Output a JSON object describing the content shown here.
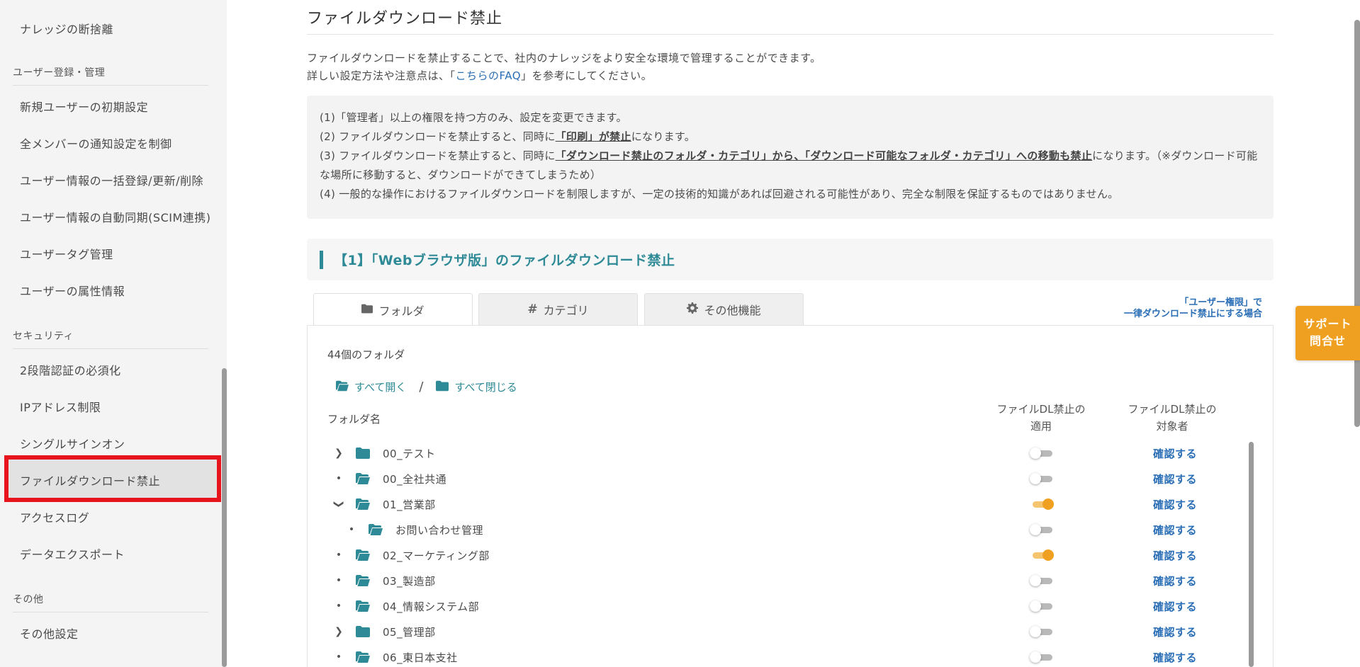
{
  "sidebar": {
    "top_item": "ナレッジの断捨離",
    "sections": [
      {
        "title": "ユーザー登録・管理",
        "items": [
          "新規ユーザーの初期設定",
          "全メンバーの通知設定を制御",
          "ユーザー情報の一括登録/更新/削除",
          "ユーザー情報の自動同期(SCIM連携)",
          "ユーザータグ管理",
          "ユーザーの属性情報"
        ]
      },
      {
        "title": "セキュリティ",
        "items": [
          "2段階認証の必須化",
          "IPアドレス制限",
          "シングルサインオン",
          "ファイルダウンロード禁止",
          "アクセスログ",
          "データエクスポート"
        ]
      },
      {
        "title": "その他",
        "items": [
          "その他設定"
        ]
      }
    ],
    "highlight_color": "#e8141d"
  },
  "page": {
    "title": "ファイルダウンロード禁止",
    "intro_line1": "ファイルダウンロードを禁止することで、社内のナレッジをより安全な環境で管理することができます。",
    "intro_line2_pre": "詳しい設定方法や注意点は、「",
    "intro_link": "こちらのFAQ",
    "intro_line2_post": "」を参考にしてください。"
  },
  "notes": {
    "n1": "(1)「管理者」以上の権限を持つ方のみ、設定を変更できます。",
    "n2_pre": "(2) ファイルダウンロードを禁止すると、同時に",
    "n2_u": "「印刷」が禁止",
    "n2_post": "になります。",
    "n3_pre": "(3) ファイルダウンロードを禁止すると、同時に",
    "n3_u": "「ダウンロード禁止のフォルダ・カテゴリ」から、「ダウンロード可能なフォルダ・カテゴリ」への移動も禁止",
    "n3_post": "になります。（※ダウンロード可能な場所に移動すると、ダウンロードができてしまうため）",
    "n4": "(4) 一般的な操作におけるファイルダウンロードを制限しますが、一定の技術的知識があれば回避される可能性があり、完全な制限を保証するものではありません。"
  },
  "section1": {
    "title": "【1】「Webブラウザ版」のファイルダウンロード禁止"
  },
  "tabs": [
    {
      "label": "フォルダ",
      "icon": "folder-icon"
    },
    {
      "label": "カテゴリ",
      "icon": "hash-icon"
    },
    {
      "label": "その他機能",
      "icon": "gear-icon"
    }
  ],
  "perm_link": {
    "line1": "「ユーザー権限」で",
    "line2": "一律ダウンロード禁止にする場合"
  },
  "folders": {
    "count_label": "44個のフォルダ",
    "open_all": "すべて開く",
    "separator": "/",
    "close_all": "すべて閉じる",
    "col_name": "フォルダ名",
    "col_apply_1": "ファイルDL禁止の",
    "col_apply_2": "適用",
    "col_target_1": "ファイルDL禁止の",
    "col_target_2": "対象者",
    "confirm_label": "確認する",
    "rows": [
      {
        "name": "00_テスト",
        "lead": "chevron-right",
        "icon": "folder-closed",
        "depth": 0,
        "enabled": false
      },
      {
        "name": "00_全社共通",
        "lead": "bullet",
        "icon": "folder-open",
        "depth": 0,
        "enabled": false
      },
      {
        "name": "01_営業部",
        "lead": "chevron-down",
        "icon": "folder-open",
        "depth": 0,
        "enabled": true
      },
      {
        "name": "お問い合わせ管理",
        "lead": "bullet",
        "icon": "folder-open",
        "depth": 1,
        "enabled": false
      },
      {
        "name": "02_マーケティング部",
        "lead": "bullet",
        "icon": "folder-open",
        "depth": 0,
        "enabled": true
      },
      {
        "name": "03_製造部",
        "lead": "bullet",
        "icon": "folder-open",
        "depth": 0,
        "enabled": false
      },
      {
        "name": "04_情報システム部",
        "lead": "bullet",
        "icon": "folder-open",
        "depth": 0,
        "enabled": false
      },
      {
        "name": "05_管理部",
        "lead": "chevron-right",
        "icon": "folder-closed",
        "depth": 0,
        "enabled": false
      },
      {
        "name": "06_東日本支社",
        "lead": "bullet",
        "icon": "folder-open",
        "depth": 0,
        "enabled": false
      }
    ]
  },
  "support_button": {
    "line1": "サポート",
    "line2": "問合せ"
  },
  "colors": {
    "accent": "#2e8a96",
    "link": "#2a6eb5",
    "toggle_on": "#f0a020",
    "support": "#f0a020"
  }
}
